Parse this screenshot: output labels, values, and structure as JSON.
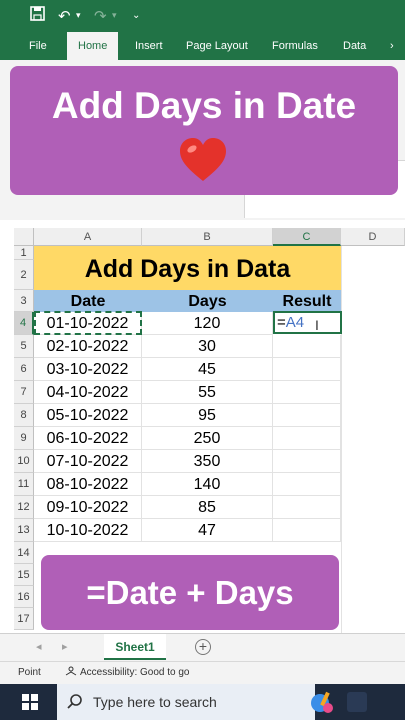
{
  "ribbon": {
    "tabs": [
      "File",
      "Home",
      "Insert",
      "Page Layout",
      "Formulas",
      "Data"
    ],
    "active_tab": "Home"
  },
  "banner_top": {
    "title": "Add Days in Date"
  },
  "banner_bottom": {
    "text": "=Date + Days"
  },
  "grid": {
    "columns": [
      "A",
      "B",
      "C",
      "D"
    ],
    "rows": [
      "1",
      "2",
      "3",
      "4",
      "5",
      "6",
      "7",
      "8",
      "9",
      "10",
      "11",
      "12",
      "13",
      "14",
      "15",
      "16",
      "17"
    ],
    "title": "Add Days in Data",
    "headers": {
      "date": "Date",
      "days": "Days",
      "result": "Result"
    },
    "dates": [
      "01-10-2022",
      "02-10-2022",
      "03-10-2022",
      "04-10-2022",
      "05-10-2022",
      "06-10-2022",
      "07-10-2022",
      "08-10-2022",
      "09-10-2022",
      "10-10-2022"
    ],
    "days": [
      "120",
      "30",
      "45",
      "55",
      "95",
      "250",
      "350",
      "140",
      "85",
      "47"
    ],
    "editing_formula_prefix": "=",
    "editing_formula_ref": "A4"
  },
  "sheets": {
    "tab": "Sheet1",
    "add": "+"
  },
  "status": {
    "mode": "Point",
    "accessibility": "Accessibility: Good to go"
  },
  "taskbar": {
    "search_placeholder": "Type here to search"
  },
  "colors": {
    "excel_green": "#217346",
    "banner_purple": "#b05fb7",
    "title_yellow": "#ffd966",
    "header_blue": "#9dc3e6",
    "heart_red": "#e4322b"
  }
}
